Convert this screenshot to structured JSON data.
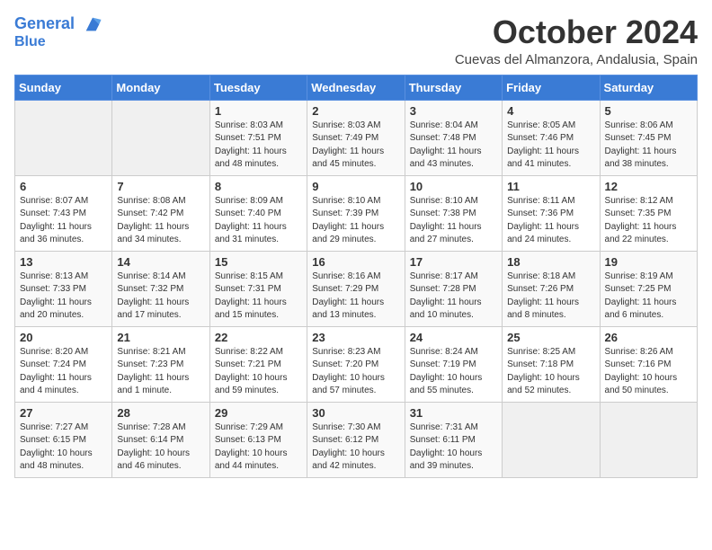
{
  "header": {
    "logo_line1": "General",
    "logo_line2": "Blue",
    "month": "October 2024",
    "location": "Cuevas del Almanzora, Andalusia, Spain"
  },
  "weekdays": [
    "Sunday",
    "Monday",
    "Tuesday",
    "Wednesday",
    "Thursday",
    "Friday",
    "Saturday"
  ],
  "weeks": [
    [
      {
        "day": "",
        "empty": true
      },
      {
        "day": "",
        "empty": true
      },
      {
        "day": "1",
        "sunrise": "Sunrise: 8:03 AM",
        "sunset": "Sunset: 7:51 PM",
        "daylight": "Daylight: 11 hours and 48 minutes."
      },
      {
        "day": "2",
        "sunrise": "Sunrise: 8:03 AM",
        "sunset": "Sunset: 7:49 PM",
        "daylight": "Daylight: 11 hours and 45 minutes."
      },
      {
        "day": "3",
        "sunrise": "Sunrise: 8:04 AM",
        "sunset": "Sunset: 7:48 PM",
        "daylight": "Daylight: 11 hours and 43 minutes."
      },
      {
        "day": "4",
        "sunrise": "Sunrise: 8:05 AM",
        "sunset": "Sunset: 7:46 PM",
        "daylight": "Daylight: 11 hours and 41 minutes."
      },
      {
        "day": "5",
        "sunrise": "Sunrise: 8:06 AM",
        "sunset": "Sunset: 7:45 PM",
        "daylight": "Daylight: 11 hours and 38 minutes."
      }
    ],
    [
      {
        "day": "6",
        "sunrise": "Sunrise: 8:07 AM",
        "sunset": "Sunset: 7:43 PM",
        "daylight": "Daylight: 11 hours and 36 minutes."
      },
      {
        "day": "7",
        "sunrise": "Sunrise: 8:08 AM",
        "sunset": "Sunset: 7:42 PM",
        "daylight": "Daylight: 11 hours and 34 minutes."
      },
      {
        "day": "8",
        "sunrise": "Sunrise: 8:09 AM",
        "sunset": "Sunset: 7:40 PM",
        "daylight": "Daylight: 11 hours and 31 minutes."
      },
      {
        "day": "9",
        "sunrise": "Sunrise: 8:10 AM",
        "sunset": "Sunset: 7:39 PM",
        "daylight": "Daylight: 11 hours and 29 minutes."
      },
      {
        "day": "10",
        "sunrise": "Sunrise: 8:10 AM",
        "sunset": "Sunset: 7:38 PM",
        "daylight": "Daylight: 11 hours and 27 minutes."
      },
      {
        "day": "11",
        "sunrise": "Sunrise: 8:11 AM",
        "sunset": "Sunset: 7:36 PM",
        "daylight": "Daylight: 11 hours and 24 minutes."
      },
      {
        "day": "12",
        "sunrise": "Sunrise: 8:12 AM",
        "sunset": "Sunset: 7:35 PM",
        "daylight": "Daylight: 11 hours and 22 minutes."
      }
    ],
    [
      {
        "day": "13",
        "sunrise": "Sunrise: 8:13 AM",
        "sunset": "Sunset: 7:33 PM",
        "daylight": "Daylight: 11 hours and 20 minutes."
      },
      {
        "day": "14",
        "sunrise": "Sunrise: 8:14 AM",
        "sunset": "Sunset: 7:32 PM",
        "daylight": "Daylight: 11 hours and 17 minutes."
      },
      {
        "day": "15",
        "sunrise": "Sunrise: 8:15 AM",
        "sunset": "Sunset: 7:31 PM",
        "daylight": "Daylight: 11 hours and 15 minutes."
      },
      {
        "day": "16",
        "sunrise": "Sunrise: 8:16 AM",
        "sunset": "Sunset: 7:29 PM",
        "daylight": "Daylight: 11 hours and 13 minutes."
      },
      {
        "day": "17",
        "sunrise": "Sunrise: 8:17 AM",
        "sunset": "Sunset: 7:28 PM",
        "daylight": "Daylight: 11 hours and 10 minutes."
      },
      {
        "day": "18",
        "sunrise": "Sunrise: 8:18 AM",
        "sunset": "Sunset: 7:26 PM",
        "daylight": "Daylight: 11 hours and 8 minutes."
      },
      {
        "day": "19",
        "sunrise": "Sunrise: 8:19 AM",
        "sunset": "Sunset: 7:25 PM",
        "daylight": "Daylight: 11 hours and 6 minutes."
      }
    ],
    [
      {
        "day": "20",
        "sunrise": "Sunrise: 8:20 AM",
        "sunset": "Sunset: 7:24 PM",
        "daylight": "Daylight: 11 hours and 4 minutes."
      },
      {
        "day": "21",
        "sunrise": "Sunrise: 8:21 AM",
        "sunset": "Sunset: 7:23 PM",
        "daylight": "Daylight: 11 hours and 1 minute."
      },
      {
        "day": "22",
        "sunrise": "Sunrise: 8:22 AM",
        "sunset": "Sunset: 7:21 PM",
        "daylight": "Daylight: 10 hours and 59 minutes."
      },
      {
        "day": "23",
        "sunrise": "Sunrise: 8:23 AM",
        "sunset": "Sunset: 7:20 PM",
        "daylight": "Daylight: 10 hours and 57 minutes."
      },
      {
        "day": "24",
        "sunrise": "Sunrise: 8:24 AM",
        "sunset": "Sunset: 7:19 PM",
        "daylight": "Daylight: 10 hours and 55 minutes."
      },
      {
        "day": "25",
        "sunrise": "Sunrise: 8:25 AM",
        "sunset": "Sunset: 7:18 PM",
        "daylight": "Daylight: 10 hours and 52 minutes."
      },
      {
        "day": "26",
        "sunrise": "Sunrise: 8:26 AM",
        "sunset": "Sunset: 7:16 PM",
        "daylight": "Daylight: 10 hours and 50 minutes."
      }
    ],
    [
      {
        "day": "27",
        "sunrise": "Sunrise: 7:27 AM",
        "sunset": "Sunset: 6:15 PM",
        "daylight": "Daylight: 10 hours and 48 minutes."
      },
      {
        "day": "28",
        "sunrise": "Sunrise: 7:28 AM",
        "sunset": "Sunset: 6:14 PM",
        "daylight": "Daylight: 10 hours and 46 minutes."
      },
      {
        "day": "29",
        "sunrise": "Sunrise: 7:29 AM",
        "sunset": "Sunset: 6:13 PM",
        "daylight": "Daylight: 10 hours and 44 minutes."
      },
      {
        "day": "30",
        "sunrise": "Sunrise: 7:30 AM",
        "sunset": "Sunset: 6:12 PM",
        "daylight": "Daylight: 10 hours and 42 minutes."
      },
      {
        "day": "31",
        "sunrise": "Sunrise: 7:31 AM",
        "sunset": "Sunset: 6:11 PM",
        "daylight": "Daylight: 10 hours and 39 minutes."
      },
      {
        "day": "",
        "empty": true
      },
      {
        "day": "",
        "empty": true
      }
    ]
  ]
}
